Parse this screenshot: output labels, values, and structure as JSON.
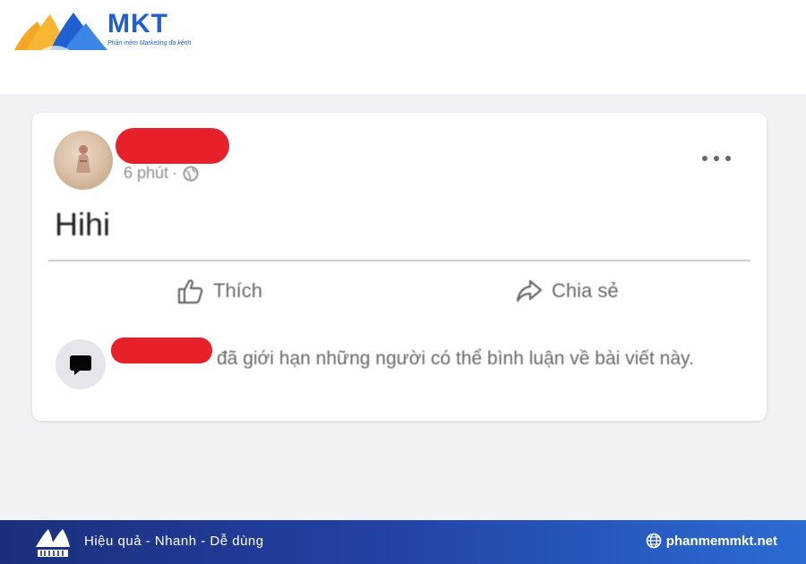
{
  "brand": {
    "name": "MKT",
    "tagline": "Phần mềm Marketing đa kênh"
  },
  "post": {
    "time": "6 phút",
    "separator": "·",
    "text": "Hihi",
    "actions": {
      "like": "Thích",
      "share": "Chia sẻ"
    },
    "notice": "đã giới hạn những người có thể bình luận về bài viết này."
  },
  "footer": {
    "slogan": "Hiệu quả - Nhanh - Dễ dùng",
    "website": "phanmemmkt.net"
  },
  "colors": {
    "redaction": "#e8202a",
    "brand_blue": "#1f5fd1",
    "brand_orange": "#f5a623",
    "footer_start": "#1b2f7c",
    "footer_end": "#2b6cd3"
  },
  "icons": [
    "mkt-logo-icon",
    "globe-icon",
    "more-icon",
    "like-icon",
    "share-icon",
    "comment-bubble-icon",
    "world-icon"
  ]
}
